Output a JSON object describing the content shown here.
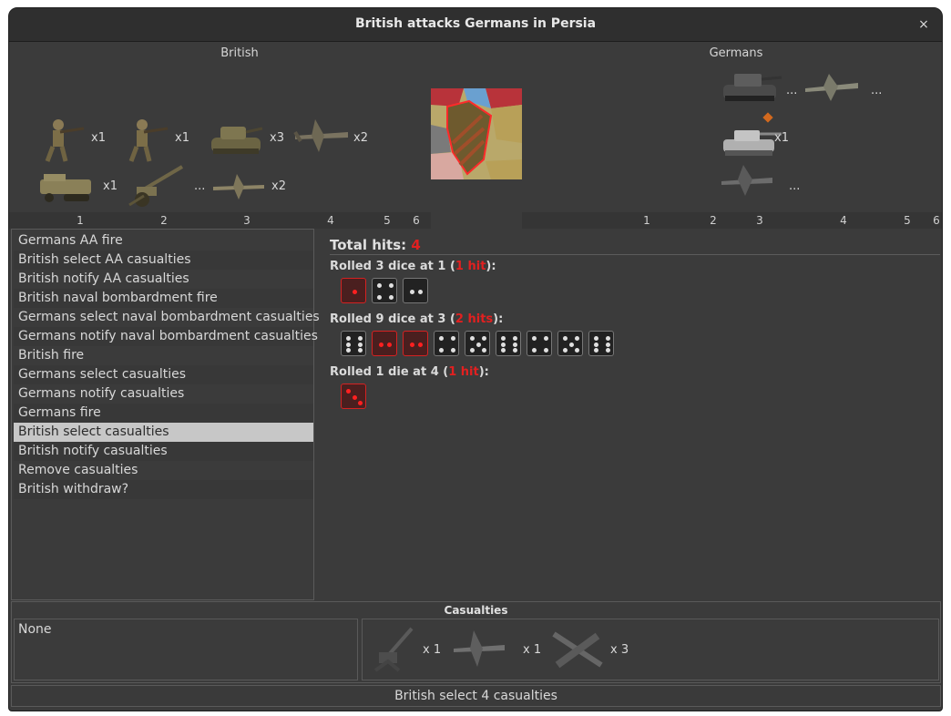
{
  "window": {
    "title": "British attacks Germans in Persia",
    "close_glyph": "×"
  },
  "attacker": {
    "label": "British",
    "units": [
      {
        "icon": "infantry-icon",
        "count": "x1"
      },
      {
        "icon": "infantry-icon",
        "count": "x1"
      },
      {
        "icon": "tank-icon",
        "count": "x3"
      },
      {
        "icon": "bomber-icon",
        "count": "x2"
      },
      {
        "icon": "halftrack-icon",
        "count": "x1"
      },
      {
        "icon": "artillery-icon",
        "count": "..."
      },
      {
        "icon": "fighter-icon",
        "count": "x2"
      }
    ],
    "dice_columns": [
      "1",
      "2",
      "3",
      "4",
      "5",
      "6"
    ]
  },
  "defender": {
    "label": "Germans",
    "units": [
      {
        "icon": "tank-icon",
        "count": "..."
      },
      {
        "icon": "fighter-icon",
        "count": "..."
      },
      {
        "icon": "heavy-tank-icon",
        "count": "x1"
      },
      {
        "icon": "fighter-icon",
        "count": "..."
      }
    ],
    "dice_columns": [
      "1",
      "2",
      "3",
      "4",
      "5",
      "6"
    ]
  },
  "territory": {
    "icon": "persia-map-icon"
  },
  "steps": [
    "Germans AA fire",
    "British select AA casualties",
    "British notify AA casualties",
    "British naval bombardment fire",
    "Germans select naval bombardment casualties",
    "Germans notify naval bombardment casualties",
    "British fire",
    "Germans select casualties",
    "Germans notify casualties",
    "Germans fire",
    "British select casualties",
    "British notify casualties",
    "Remove casualties",
    "British withdraw?"
  ],
  "selected_step": 10,
  "results": {
    "total_label": "Total hits:",
    "total_value": "4",
    "rolls": [
      {
        "prefix": "Rolled 3 dice at 1 (",
        "hits": "1 hit",
        "suffix": "):",
        "dice": [
          1,
          4,
          2
        ],
        "hit_flags": [
          true,
          false,
          false
        ]
      },
      {
        "prefix": "Rolled 9 dice at 3 (",
        "hits": "2 hits",
        "suffix": "):",
        "dice": [
          6,
          2,
          2,
          4,
          5,
          6,
          4,
          5,
          6
        ],
        "hit_flags": [
          false,
          true,
          true,
          false,
          false,
          false,
          false,
          false,
          false
        ]
      },
      {
        "prefix": "Rolled 1 die at 4 (",
        "hits": "1 hit",
        "suffix": "):",
        "dice": [
          3
        ],
        "hit_flags": [
          true
        ]
      }
    ]
  },
  "casualties": {
    "title": "Casualties",
    "left_text": "None",
    "units": [
      {
        "icon": "aa-gun-icon",
        "count": "x 1"
      },
      {
        "icon": "bomber-icon",
        "count": "x 1"
      },
      {
        "icon": "bomber-icon",
        "count": "x 3"
      }
    ]
  },
  "status": {
    "button_label": "British select 4 casualties"
  },
  "colors": {
    "hit": "#e02020",
    "background": "#3b3b3b",
    "selected_row": "#c7c7c7"
  }
}
